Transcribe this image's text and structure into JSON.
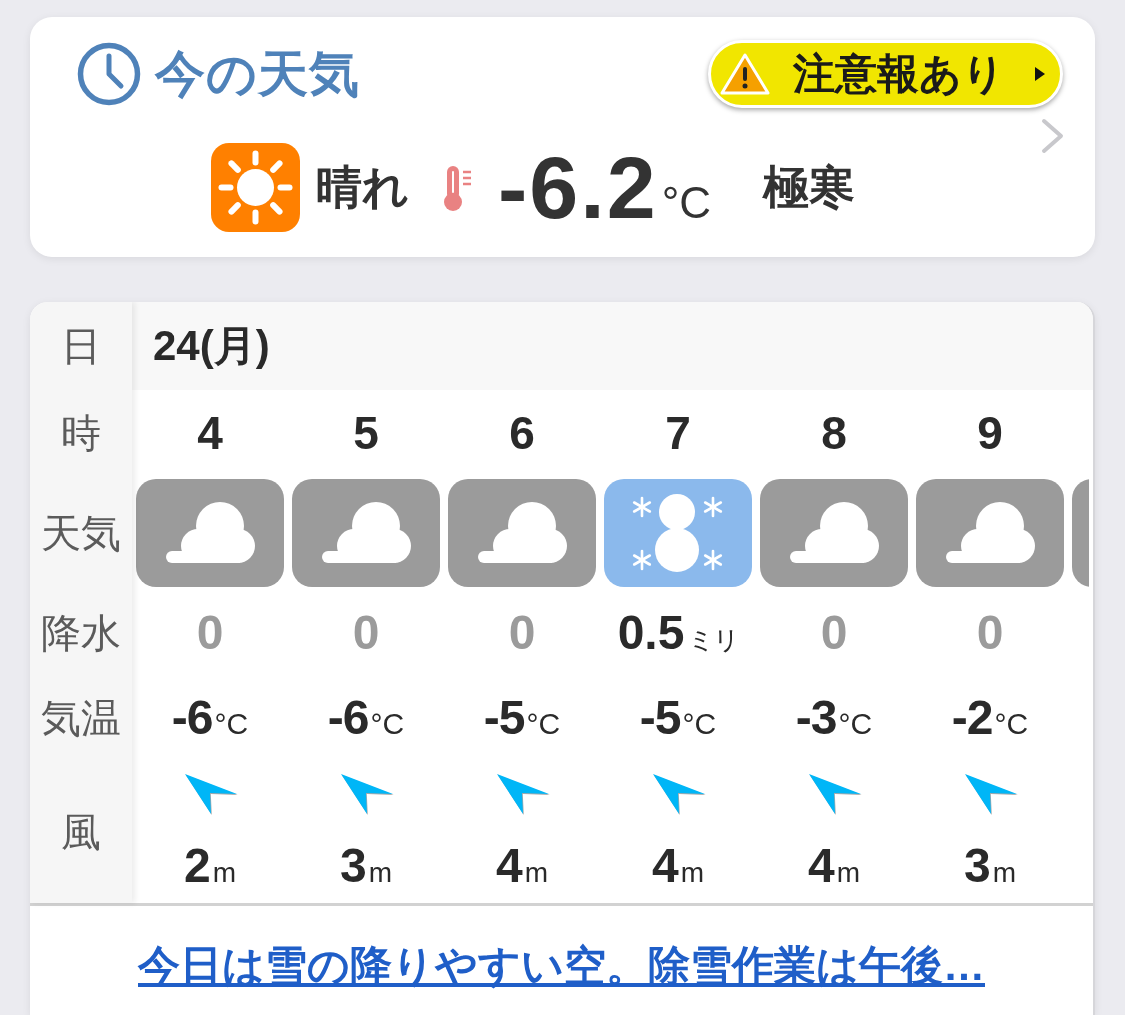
{
  "current": {
    "title": "今の天気",
    "alert": {
      "label": "注意報あり"
    },
    "weather_icon": {
      "kind": "sunny"
    },
    "condition": "晴れ",
    "temperature": "-6.2",
    "temperature_unit": "°C",
    "feel": "極寒"
  },
  "hourly": {
    "row_labels": [
      "日",
      "時",
      "天気",
      "降水",
      "気温",
      "風"
    ],
    "date": "24(月)",
    "hours": [
      {
        "kind": "cloudy",
        "hour": "4",
        "precipitation": "0",
        "dry": true,
        "temperature": "-6",
        "temperature_unit": "°C",
        "wind": {
          "kind": "northwest",
          "speed": "2",
          "unit": "m"
        }
      },
      {
        "kind": "cloudy",
        "hour": "5",
        "precipitation": "0",
        "dry": true,
        "temperature": "-6",
        "temperature_unit": "°C",
        "wind": {
          "kind": "northwest",
          "speed": "3",
          "unit": "m"
        }
      },
      {
        "kind": "cloudy",
        "hour": "6",
        "precipitation": "0",
        "dry": true,
        "temperature": "-5",
        "temperature_unit": "°C",
        "wind": {
          "kind": "northwest",
          "speed": "4",
          "unit": "m"
        }
      },
      {
        "kind": "snow",
        "hour": "7",
        "precipitation": "0.5",
        "precipitation_unit": "ミリ",
        "dry": false,
        "temperature": "-5",
        "temperature_unit": "°C",
        "wind": {
          "kind": "northwest",
          "speed": "4",
          "unit": "m"
        }
      },
      {
        "kind": "cloudy",
        "hour": "8",
        "precipitation": "0",
        "dry": true,
        "temperature": "-3",
        "temperature_unit": "°C",
        "wind": {
          "kind": "northwest",
          "speed": "4",
          "unit": "m"
        }
      },
      {
        "kind": "cloudy",
        "hour": "9",
        "precipitation": "0",
        "dry": true,
        "temperature": "-2",
        "temperature_unit": "°C",
        "wind": {
          "kind": "northwest",
          "speed": "3",
          "unit": "m"
        }
      },
      {
        "kind": "cloudy"
      }
    ]
  },
  "forecast_link": "今日は雪の降りやすい空。除雪作業は午後…"
}
